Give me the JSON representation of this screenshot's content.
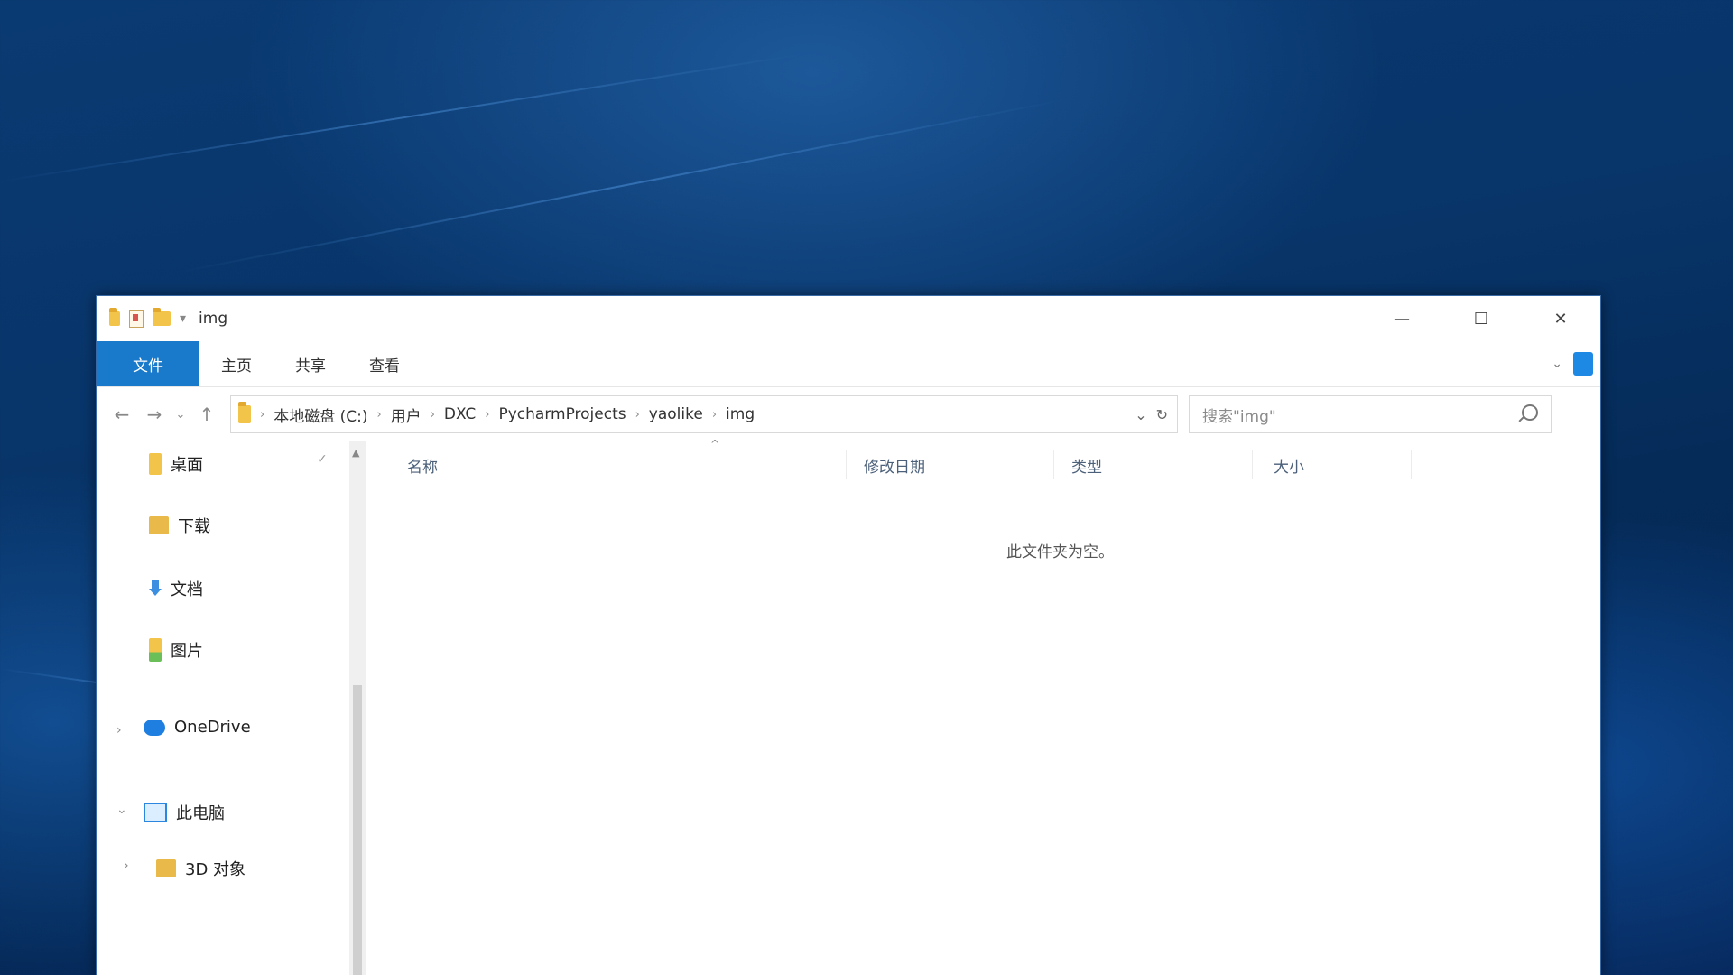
{
  "window": {
    "title": "img",
    "controls": {
      "minimize": "—",
      "maximize": "☐",
      "close": "✕"
    }
  },
  "ribbon": {
    "tabs": [
      "文件",
      "主页",
      "共享",
      "查看"
    ],
    "expand": "⌄"
  },
  "nav": {
    "back": "←",
    "forward": "→",
    "recent": "⌄",
    "up": "↑",
    "breadcrumbs": [
      "本地磁盘 (C:)",
      "用户",
      "DXC",
      "PycharmProjects",
      "yaolike",
      "img"
    ],
    "history_dropdown": "⌄",
    "refresh": "↻",
    "search_placeholder": "搜索\"img\""
  },
  "sidebar": {
    "quick_access": [
      {
        "label": "桌面",
        "icon": "pin-folder-icon"
      },
      {
        "label": "下载",
        "icon": "folder-icon"
      },
      {
        "label": "文档",
        "icon": "download-icon"
      },
      {
        "label": "图片",
        "icon": "pictures-icon"
      }
    ],
    "onedrive": "OneDrive",
    "this_pc": "此电脑",
    "next_item": "3D 对象",
    "pin_glyph": "✓"
  },
  "content": {
    "columns": [
      "名称",
      "修改日期",
      "类型",
      "大小"
    ],
    "empty_message": "此文件夹为空。"
  },
  "colors": {
    "file_tab": "#1979ca",
    "window_border": "#3a6aa5",
    "desktop": "#08356a"
  }
}
